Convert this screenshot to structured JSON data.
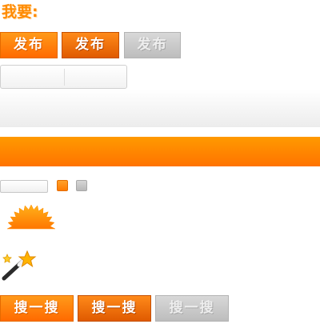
{
  "heading": "我要:",
  "publish_buttons": [
    {
      "label": "发布",
      "state": "normal"
    },
    {
      "label": "发布",
      "state": "hover"
    },
    {
      "label": "发布",
      "state": "disabled"
    }
  ],
  "search_buttons": [
    {
      "label": "搜一搜",
      "state": "normal"
    },
    {
      "label": "搜一搜",
      "state": "hover"
    },
    {
      "label": "搜一搜",
      "state": "disabled"
    }
  ],
  "icons": {
    "sunburst": "half-sun-icon",
    "wand": "magic-wand-icon"
  },
  "colors": {
    "accent": "#ff7a00",
    "accent_dark": "#e05a00",
    "disabled": "#bdbdbd"
  }
}
